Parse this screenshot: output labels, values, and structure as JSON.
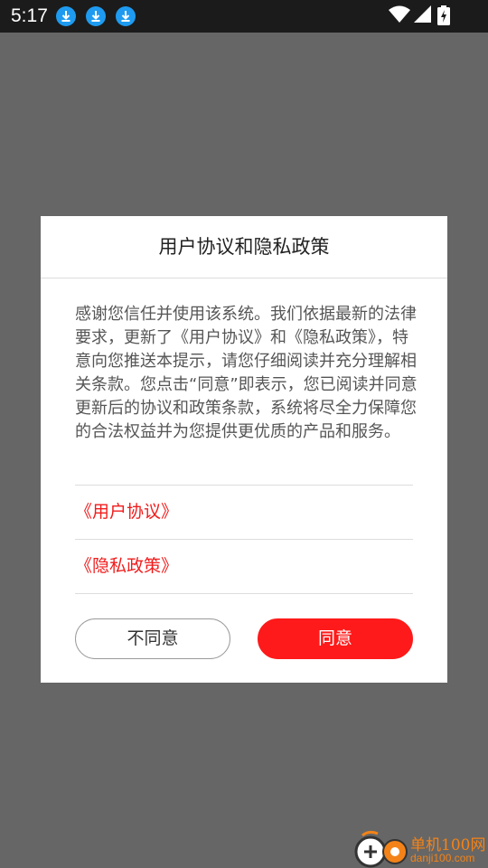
{
  "status_bar": {
    "time": "5:17",
    "icons": [
      "download-icon",
      "download-icon",
      "download-icon",
      "wifi-icon",
      "cell-signal-icon",
      "battery-icon"
    ]
  },
  "dialog": {
    "title": "用户协议和隐私政策",
    "body": "感谢您信任并使用该系统。我们依据最新的法律要求，更新了《用户协议》和《隐私政策》，特意向您推送本提示，请您仔细阅读并充分理解相关条款。您点击“同意”即表示，您已阅读并同意更新后的协议和政策条款，系统将尽全力保障您的合法权益并为您提供更优质的产品和服务。",
    "links": {
      "user_agreement": "《用户协议》",
      "privacy_policy": "《隐私政策》"
    },
    "buttons": {
      "disagree": "不同意",
      "agree": "同意"
    }
  },
  "watermark": {
    "name": "单机100网",
    "url": "danji100.com"
  },
  "colors": {
    "accent": "#fe1a1a",
    "link": "#f01c1c",
    "overlay": "#666666",
    "status_bar": "#1b1b1b",
    "download_icon": "#1e9bf0",
    "watermark": "#f38318"
  }
}
